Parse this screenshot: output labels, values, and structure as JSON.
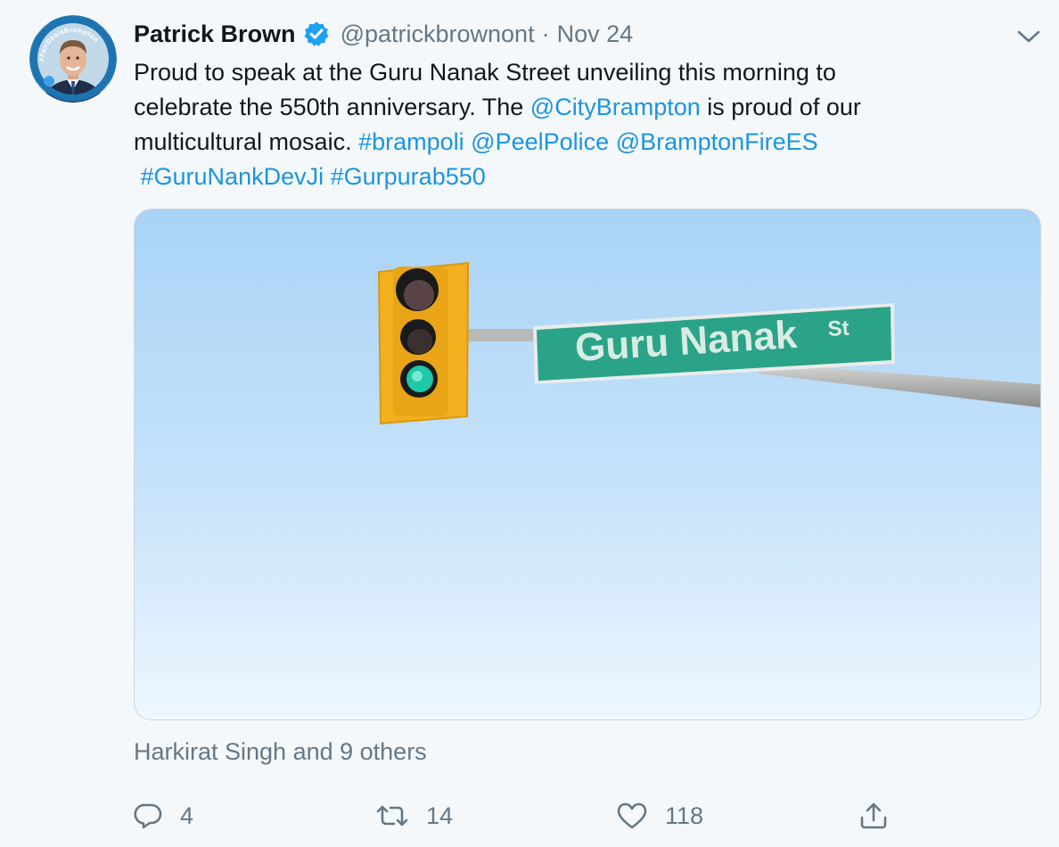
{
  "tweet": {
    "author": {
      "display_name": "Patrick Brown",
      "verified": true,
      "handle": "@patrickbrownont",
      "avatar_badge_text": "#FairDeal4Brampton"
    },
    "separator": "·",
    "date": "Nov 24",
    "text_segments": {
      "s1": "Proud to speak at the Guru Nanak Street unveiling this morning to",
      "s2": "celebrate the 550th anniversary. The ",
      "s3": "@CityBrampton",
      "s4": " is proud of our",
      "s5": "multicultural mosaic. ",
      "s6": "#brampoli",
      "s7": "@PeelPolice",
      "s8": "@BramptonFireES",
      "s9": "#GuruNankDevJi",
      "s10": "#Gurpurab550"
    },
    "media": {
      "street_sign_text": "Guru Nanak",
      "street_sign_suffix": "St"
    },
    "liked_by": "Harkirat Singh and 9 others",
    "actions": {
      "reply_count": "4",
      "retweet_count": "14",
      "like_count": "118"
    },
    "colors": {
      "link": "#1b95e0",
      "muted": "#657786",
      "verified_badge": "#1da1f2",
      "sign_green": "#2aa388",
      "signal_housing": "#f2b01e"
    },
    "icons": [
      "verified-badge-icon",
      "chevron-down-icon",
      "reply-icon",
      "retweet-icon",
      "like-icon",
      "share-icon"
    ]
  }
}
